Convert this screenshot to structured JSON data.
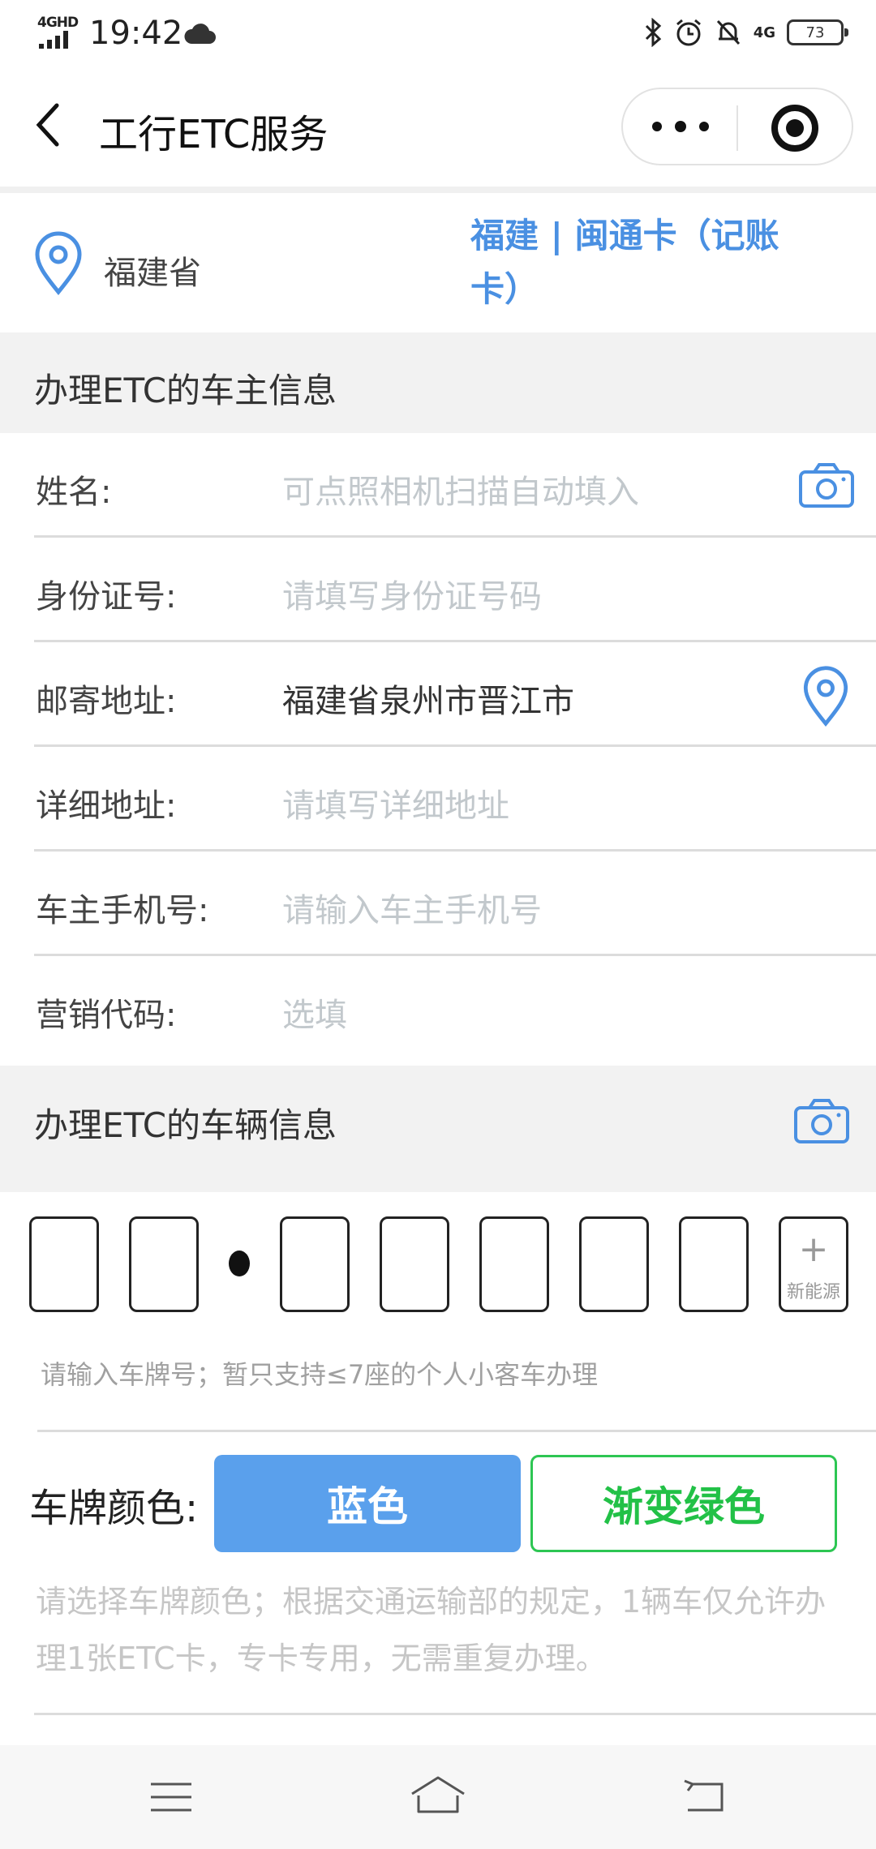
{
  "status_bar": {
    "network": "4GHD",
    "time": "19:42",
    "right_network": "4G",
    "battery": "73"
  },
  "nav": {
    "title": "工行ETC服务"
  },
  "location": {
    "province": "福建省",
    "card_type": "福建 | 闽通卡（记账卡）"
  },
  "owner_section": {
    "title": "办理ETC的车主信息",
    "fields": [
      {
        "label": "姓名:",
        "placeholder": "可点照相机扫描自动填入",
        "value": ""
      },
      {
        "label": "身份证号:",
        "placeholder": "请填写身份证号码",
        "value": ""
      },
      {
        "label": "邮寄地址:",
        "placeholder": "",
        "value": "福建省泉州市晋江市"
      },
      {
        "label": "详细地址:",
        "placeholder": "请填写详细地址",
        "value": ""
      },
      {
        "label": "车主手机号:",
        "placeholder": "请输入车主手机号",
        "value": ""
      },
      {
        "label": "营销代码:",
        "placeholder": "选填",
        "value": ""
      }
    ]
  },
  "vehicle_section": {
    "title": "办理ETC的车辆信息",
    "new_energy_plus": "+",
    "new_energy_label": "新能源",
    "plate_hint": "请输入车牌号；暂只支持≤7座的个人小客车办理",
    "color_label": "车牌颜色:",
    "color_blue": "蓝色",
    "color_green": "渐变绿色",
    "color_hint": "请选择车牌颜色；根据交通运输部的规定，1辆车仅允许办理1张ETC卡，专卡专用，无需重复办理。"
  }
}
